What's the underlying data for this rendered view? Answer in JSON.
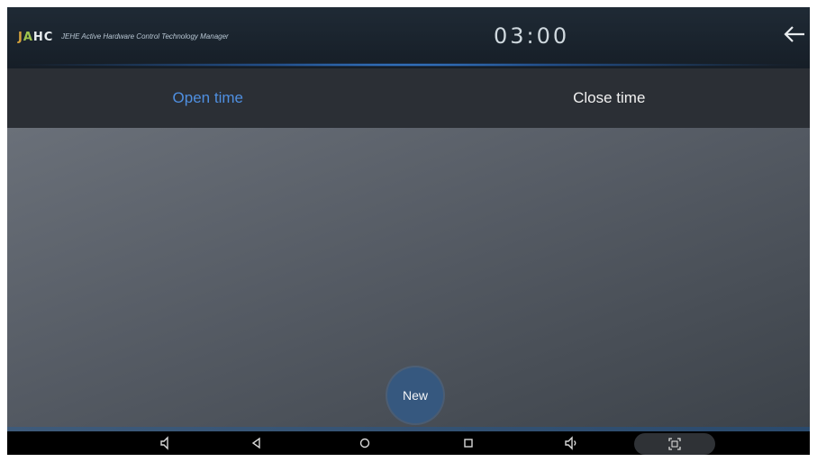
{
  "header": {
    "logo": {
      "part1": "J",
      "part2": "A",
      "part3": "HC"
    },
    "app_title": "JEHE Active Hardware Control Technology Manager",
    "clock": "03:00",
    "back_icon": "back-arrow-icon"
  },
  "tabs": [
    {
      "label": "Open time",
      "active": true
    },
    {
      "label": "Close time",
      "active": false
    }
  ],
  "main": {
    "new_button_label": "New"
  },
  "navbar": {
    "icons": [
      "volume-down-icon",
      "back-triangle-icon",
      "home-circle-icon",
      "recents-square-icon",
      "volume-up-icon",
      "screenshot-icon"
    ]
  },
  "colors": {
    "active_tab": "#4f8fe0",
    "header_glow": "#4aa3ff",
    "new_button": "#36587f"
  }
}
